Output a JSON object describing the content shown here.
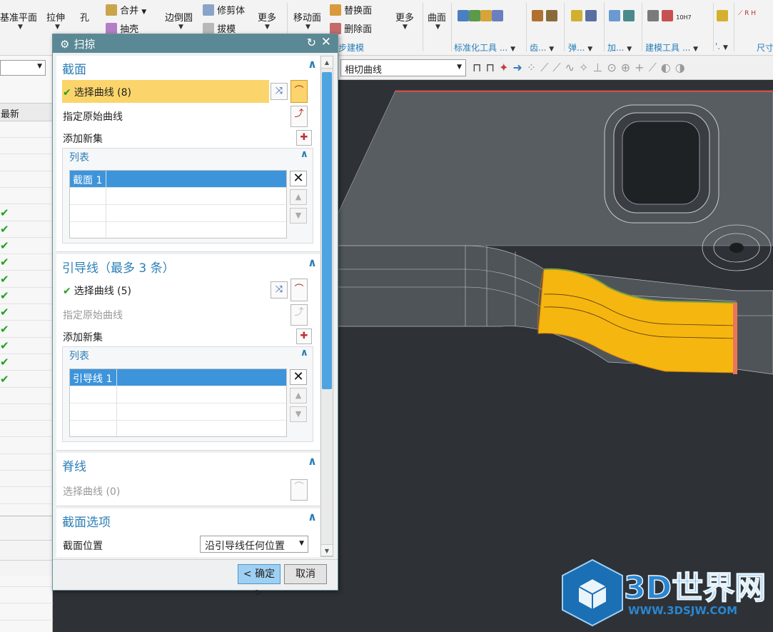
{
  "ribbon": {
    "buttons": [
      {
        "id": "datum-plane",
        "label": "基准平面"
      },
      {
        "id": "extrude",
        "label": "拉伸"
      },
      {
        "id": "hole",
        "label": "孔"
      },
      {
        "id": "unite",
        "label": "合并"
      },
      {
        "id": "shell",
        "label": "抽壳"
      },
      {
        "id": "edge-blend",
        "label": "边倒圆"
      },
      {
        "id": "trim-body",
        "label": "修剪体"
      },
      {
        "id": "draft",
        "label": "拔模"
      },
      {
        "id": "more1",
        "label": "更多"
      },
      {
        "id": "move-face",
        "label": "移动面"
      },
      {
        "id": "replace-face",
        "label": "替换面"
      },
      {
        "id": "delete-face",
        "label": "删除面"
      },
      {
        "id": "more2",
        "label": "更多"
      },
      {
        "id": "surface",
        "label": "曲面"
      }
    ],
    "groups": {
      "sync_modeling": "步建模",
      "standard_tools": "标准化工具 ...",
      "gear": "齿...",
      "spring": "弹...",
      "add": "加...",
      "modeling_tools": "建模工具 ...",
      "dim_short": "'.",
      "dims": "尺寸"
    },
    "icons": {
      "tolerance_label": "10H7",
      "tol_mark": "R H"
    }
  },
  "left_panel": {
    "column_header": "最新",
    "checked_rows": 11
  },
  "selection_bar": {
    "curve_rule": "相切曲线"
  },
  "dialog": {
    "title": "扫掠",
    "sections": {
      "section": {
        "title": "截面",
        "select_curve": "选择曲线 (8)",
        "specify_origin": "指定原始曲线",
        "add_new_set": "添加新集",
        "list_title": "列表",
        "list_item": "截面 1"
      },
      "guides": {
        "title": "引导线（最多 3 条）",
        "select_curve": "选择曲线 (5)",
        "specify_origin": "指定原始曲线",
        "add_new_set": "添加新集",
        "list_title": "列表",
        "list_item": "引导线 1"
      },
      "spine": {
        "title": "脊线",
        "select_curve": "选择曲线 (0)"
      },
      "section_options": {
        "title": "截面选项",
        "position_label": "截面位置",
        "position_value": "沿引导线任何位置"
      }
    },
    "ok": "< 确定 >",
    "cancel": "取消"
  },
  "watermark": {
    "brand": "3D世界网",
    "url": "WWW.3DSJW.COM"
  },
  "colors": {
    "dialog_title_bg": "#5a8894",
    "section_title": "#2d7fb6",
    "highlight": "#fbd56b",
    "selected_row": "#3d94db",
    "viewport_bg": "#2e3236",
    "model_surface": "#5c6166",
    "sweep_face": "#f5b60f"
  }
}
